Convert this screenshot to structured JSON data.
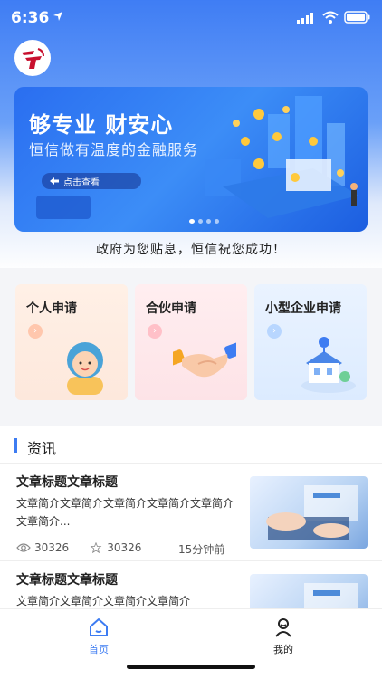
{
  "status_bar": {
    "time": "6:36"
  },
  "banner": {
    "slogan": "够专业 财安心",
    "subtitle": "恒信做有温度的金融服务",
    "cta_label": "点击查看",
    "dots": 4,
    "active_dot": 0
  },
  "tagline": "政府为您贴息，恒信祝您成功！",
  "cards": [
    {
      "label": "个人申请",
      "icon": "person-icon"
    },
    {
      "label": "合伙申请",
      "icon": "handshake-icon"
    },
    {
      "label": "小型企业申请",
      "icon": "building-icon"
    }
  ],
  "news": {
    "title": "资讯",
    "articles": [
      {
        "title": "文章标题文章标题",
        "desc": "文章简介文章简介文章简介文章简介文章简介文章简介...",
        "views": "30326",
        "likes": "30326",
        "time": "15分钟前"
      },
      {
        "title": "文章标题文章标题",
        "desc": "文章简介文章简介文章简介文章简介",
        "views": "",
        "likes": "",
        "time": ""
      }
    ]
  },
  "tabs": [
    {
      "label": "首页",
      "icon": "home-icon",
      "active": true
    },
    {
      "label": "我的",
      "icon": "profile-icon",
      "active": false
    }
  ],
  "colors": {
    "accent": "#3d7cf2",
    "banner": "#2a6ef0"
  }
}
